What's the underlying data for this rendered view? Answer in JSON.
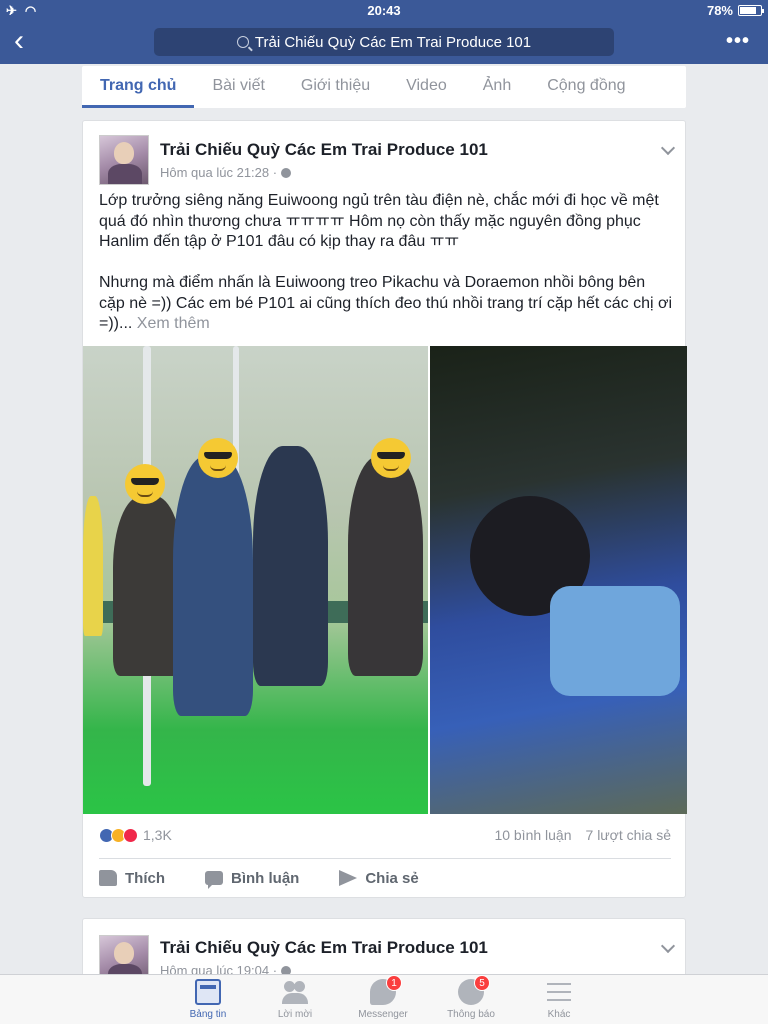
{
  "status_bar": {
    "time": "20:43",
    "battery": "78%"
  },
  "nav": {
    "search_text": "Trải Chiếu Quỳ Các Em Trai Produce 101"
  },
  "tabs": [
    {
      "label": "Trang chủ"
    },
    {
      "label": "Bài viết"
    },
    {
      "label": "Giới thiệu"
    },
    {
      "label": "Video"
    },
    {
      "label": "Ảnh"
    },
    {
      "label": "Cộng đồng"
    }
  ],
  "post1": {
    "page_name": "Trải Chiếu Quỳ Các Em Trai Produce 101",
    "time": "Hôm qua lúc 21:28 ·",
    "text": "Lớp trưởng siêng năng Euiwoong ngủ trên tàu điện nè, chắc mới đi học về mệt quá đó nhìn thương chưa ㅠㅠㅠㅠ Hôm nọ còn thấy mặc nguyên đồng phục Hanlim đến tập ở P101 đâu có kịp thay ra đâu ㅠㅠ\n\nNhưng mà điểm nhấn là Euiwoong treo Pikachu và Doraemon nhồi bông bên cặp nè =)) Các em bé P101 ai cũng thích đeo thú nhồi trang trí cặp hết các chị ơi =))...",
    "see_more": "Xem thêm",
    "reaction_count": "1,3K",
    "comments": "10 bình luận",
    "shares": "7 lượt chia sẻ",
    "actions": {
      "like": "Thích",
      "comment": "Bình luận",
      "share": "Chia sẻ"
    }
  },
  "post2": {
    "page_name": "Trải Chiếu Quỳ Các Em Trai Produce 101",
    "time": "Hôm qua lúc 19:04 ·"
  },
  "tabbar": [
    {
      "label": "Bảng tin",
      "icon": "news-feed-icon"
    },
    {
      "label": "Lời mời",
      "icon": "friend-requests-icon"
    },
    {
      "label": "Messenger",
      "icon": "messenger-icon",
      "badge": "1"
    },
    {
      "label": "Thông báo",
      "icon": "globe-icon",
      "badge": "5"
    },
    {
      "label": "Khác",
      "icon": "menu-icon"
    }
  ],
  "colors": {
    "brand": "#3b5998",
    "accent": "#4267b2",
    "badge": "#fa3e3e"
  }
}
